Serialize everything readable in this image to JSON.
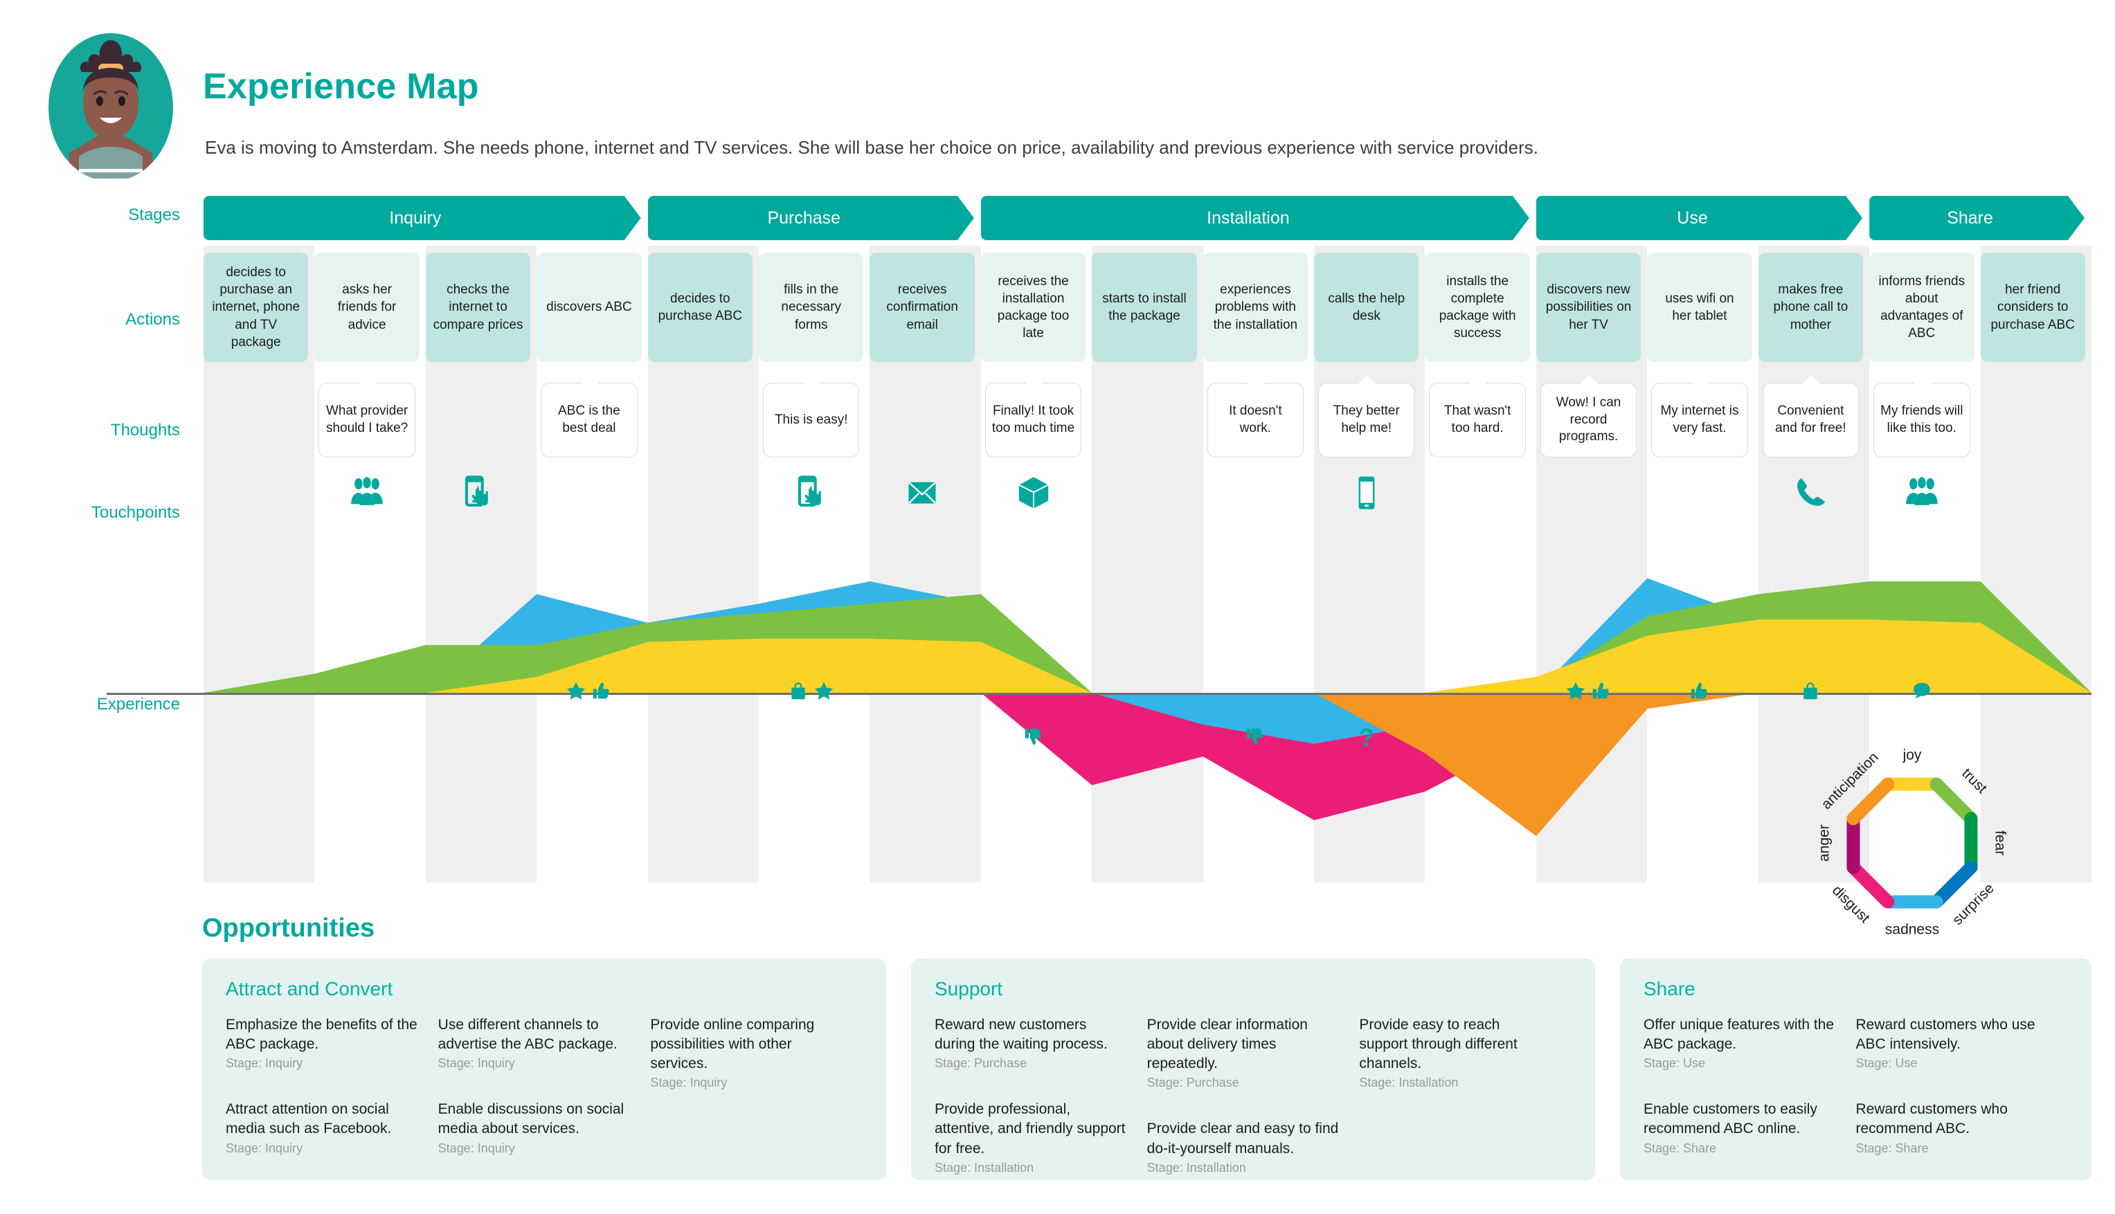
{
  "header": {
    "title": "Experience Map",
    "subtitle": "Eva is moving to Amsterdam. She needs phone, internet and TV services. She will base her choice on price, availability and previous experience with service providers.",
    "avatar_name": "persona-avatar"
  },
  "row_labels": {
    "stages": "Stages",
    "actions": "Actions",
    "thoughts": "Thoughts",
    "touchpoints": "Touchpoints",
    "experience": "Experience"
  },
  "stages": [
    {
      "label": "Inquiry",
      "span": 4
    },
    {
      "label": "Purchase",
      "span": 3
    },
    {
      "label": "Installation",
      "span": 5
    },
    {
      "label": "Use",
      "span": 3
    },
    {
      "label": "Share",
      "span": 2
    }
  ],
  "actions": [
    "decides to purchase an internet, phone and TV package",
    "asks her friends for advice",
    "checks the internet to compare prices",
    "discovers ABC",
    "decides to purchase ABC",
    "fills in the necessary forms",
    "receives confirmation email",
    "receives the installation package too late",
    "starts to install the package",
    "experiences problems with the installation",
    "calls the help desk",
    "installs the complete package with success",
    "discovers new possibilities on her TV",
    "uses wifi on her tablet",
    "makes free phone call to mother",
    "informs friends about advantages of ABC",
    "her friend considers to purchase ABC"
  ],
  "thoughts": [
    "",
    "What provider should I take?",
    "",
    "ABC is the best deal",
    "",
    "This is easy!",
    "",
    "Finally! It took too much time",
    "",
    "It doesn't work.",
    "They better help me!",
    "That wasn't too hard.",
    "Wow! I can record programs.",
    "My internet is very fast.",
    "Convenient and for free!",
    "My friends will like this too.",
    ""
  ],
  "touchpoints": [
    "",
    "people-icon",
    "mobile-tap-icon",
    "",
    "",
    "mobile-tap-icon",
    "envelope-icon",
    "package-box-icon",
    "",
    "",
    "smartphone-icon",
    "",
    "",
    "",
    "phone-call-icon",
    "people-icon",
    ""
  ],
  "experience_marks_above": [
    "",
    "",
    "",
    "star-icon,thumbs-up-icon",
    "",
    "shopping-bag-icon,star-icon",
    "",
    "",
    "",
    "",
    "",
    "",
    "star-icon,thumbs-up-icon",
    "thumbs-up-icon",
    "shopping-bag-icon",
    "speech-bubble-icon",
    ""
  ],
  "experience_marks_below": [
    "",
    "",
    "",
    "",
    "",
    "",
    "",
    "thumbs-down-icon",
    "",
    "thumbs-down-icon",
    "question-mark-icon",
    "",
    "",
    "",
    "",
    "",
    ""
  ],
  "emotion_wheel": {
    "name": "emotion-wheel-legend",
    "segments": [
      {
        "label": "joy",
        "color": "#fbd226"
      },
      {
        "label": "trust",
        "color": "#7cc142"
      },
      {
        "label": "fear",
        "color": "#009a49"
      },
      {
        "label": "surprise",
        "color": "#0076bd"
      },
      {
        "label": "sadness",
        "color": "#35b4e8"
      },
      {
        "label": "disgust",
        "color": "#ec1d77"
      },
      {
        "label": "anger",
        "color": "#a80a6e"
      },
      {
        "label": "anticipation",
        "color": "#f59522"
      }
    ]
  },
  "chart_data": {
    "type": "area",
    "title": "Experience",
    "xlabel": "",
    "ylabel": "",
    "grid": false,
    "legend": "emotion-wheel",
    "categories": [
      "decides to purchase an internet, phone and TV package",
      "asks her friends for advice",
      "checks the internet to compare prices",
      "discovers ABC",
      "decides to purchase ABC",
      "fills in the necessary forms",
      "receives confirmation email",
      "receives the installation package too late",
      "starts to install the package",
      "experiences problems with the installation",
      "calls the help desk",
      "installs the complete package with success",
      "discovers new possibilities on her TV",
      "uses wifi on her tablet",
      "makes free phone call to mother",
      "informs friends about advantages of ABC",
      "her friend considers to purchase ABC"
    ],
    "ylim": [
      -100,
      100
    ],
    "series": [
      {
        "name": "joy",
        "color": "#fbd226",
        "values": [
          0,
          0,
          0,
          10,
          32,
          34,
          34,
          32,
          0,
          0,
          0,
          0,
          10,
          36,
          46,
          46,
          44,
          0
        ]
      },
      {
        "name": "trust",
        "color": "#7cc142",
        "values": [
          0,
          12,
          30,
          30,
          44,
          50,
          56,
          62,
          0,
          0,
          0,
          0,
          4,
          48,
          62,
          70,
          70,
          0
        ]
      },
      {
        "name": "surprise",
        "color": "#35b4e8",
        "values": [
          0,
          0,
          0,
          62,
          44,
          56,
          70,
          56,
          0,
          0,
          0,
          0,
          0,
          72,
          46,
          36,
          26,
          0
        ]
      },
      {
        "name": "disgust",
        "color": "#ec1d77",
        "values": [
          0,
          0,
          0,
          0,
          0,
          0,
          0,
          0,
          -58,
          -40,
          -80,
          -62,
          -26,
          0,
          0,
          0,
          0,
          0
        ]
      },
      {
        "name": "sadness",
        "color": "#35b4e8",
        "values": [
          0,
          0,
          0,
          0,
          0,
          0,
          0,
          0,
          0,
          -20,
          -32,
          -20,
          0,
          0,
          0,
          0,
          0,
          0
        ]
      },
      {
        "name": "anticipation",
        "color": "#f59522",
        "values": [
          0,
          0,
          0,
          0,
          0,
          0,
          0,
          0,
          0,
          0,
          0,
          -38,
          -90,
          -10,
          0,
          0,
          0,
          0
        ]
      }
    ]
  },
  "opportunities": {
    "title": "Opportunities",
    "groups": [
      {
        "name": "Attract and Convert",
        "columns": [
          [
            {
              "text": "Emphasize the benefits of the ABC package.",
              "stage": "Stage: Inquiry"
            },
            {
              "text": "Attract attention on social media such as Facebook.",
              "stage": "Stage: Inquiry"
            }
          ],
          [
            {
              "text": "Use different channels to advertise the ABC package.",
              "stage": "Stage: Inquiry"
            },
            {
              "text": "Enable discussions on social media about services.",
              "stage": "Stage: Inquiry"
            }
          ],
          [
            {
              "text": "Provide online comparing possibilities with other services.",
              "stage": "Stage: Inquiry"
            }
          ]
        ]
      },
      {
        "name": "Support",
        "columns": [
          [
            {
              "text": "Reward new customers during the waiting process.",
              "stage": "Stage: Purchase"
            },
            {
              "text": "Provide professional, attentive, and friendly support for free.",
              "stage": "Stage: Installation"
            }
          ],
          [
            {
              "text": "Provide clear information about delivery times repeatedly.",
              "stage": "Stage: Purchase"
            },
            {
              "text": "Provide clear and easy to find do-it-yourself manuals.",
              "stage": "Stage: Installation"
            }
          ],
          [
            {
              "text": "Provide easy to reach support through different channels.",
              "stage": "Stage: Installation"
            }
          ]
        ]
      },
      {
        "name": "Share",
        "columns": [
          [
            {
              "text": "Offer unique features with the ABC package.",
              "stage": "Stage: Use"
            },
            {
              "text": "Enable customers to easily recommend ABC online.",
              "stage": "Stage: Share"
            }
          ],
          [
            {
              "text": "Reward customers who use ABC intensively.",
              "stage": "Stage: Use"
            },
            {
              "text": "Reward customers who recommend ABC.",
              "stage": "Stage: Share"
            }
          ]
        ]
      }
    ]
  },
  "colors": {
    "brand": "#00a99d",
    "brand_light": "#00b2a0",
    "card_dark": "#bfe5e0",
    "card_light": "#e5f4f1",
    "stripe": "#efefef",
    "opp_bg": "#e4f3f0"
  }
}
